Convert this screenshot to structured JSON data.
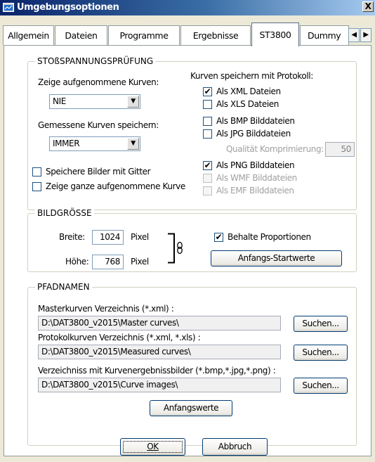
{
  "window": {
    "title": "Umgebungsoptionen",
    "close_label": "X"
  },
  "tabs": [
    {
      "label": "Allgemein"
    },
    {
      "label": "Dateien"
    },
    {
      "label": "Programme"
    },
    {
      "label": "Ergebnisse"
    },
    {
      "label": "ST3800"
    },
    {
      "label": "Dummy"
    }
  ],
  "active_tab": "ST3800",
  "tab_scroll": {
    "left_label": "◀",
    "right_label": "▶"
  },
  "stoss": {
    "title": "STOßSPANNUNGSPRÜFUNG",
    "show_curves_label": "Zeige aufgenommene Kurven:",
    "show_curves_value": "NIE",
    "save_curves_label": "Gemessene Kurven speichern:",
    "save_curves_value": "IMMER",
    "save_with_grid_label": "Speichere Bilder mit Gitter",
    "save_with_grid_checked": false,
    "show_full_curve_label": "Zeige ganze aufgenommene Kurve",
    "show_full_curve_checked": false,
    "protocol_label": "Kurven speichern mit Protokoll:",
    "as_xml_label": "Als XML Dateien",
    "as_xml_checked": true,
    "as_xls_label": "Als XLS Dateien",
    "as_xls_checked": false,
    "as_bmp_label": "Als BMP Bilddateien",
    "as_bmp_checked": false,
    "as_jpg_label": "Als JPG Bilddateien",
    "as_jpg_checked": false,
    "quality_label": "Qualität Komprimierung:",
    "quality_value": "50",
    "as_png_label": "Als PNG Bilddateien",
    "as_png_checked": true,
    "as_wmf_label": "Als WMF Bilddateien",
    "as_wmf_checked": false,
    "as_emf_label": "Als EMF Bilddateien",
    "as_emf_checked": false,
    "dropdown_glyph": "▼",
    "check_glyph": "✔"
  },
  "bildgroesse": {
    "title": "BILDGRÖSSE",
    "width_label": "Breite:",
    "width_value": "1024",
    "width_unit": "Pixel",
    "height_label": "Höhe:",
    "height_value": "768",
    "height_unit": "Pixel",
    "link_icon": "chain-link-icon",
    "keep_proportions_label": "Behalte Proportionen",
    "keep_proportions_checked": true,
    "defaults_button": "Anfangs-Startwerte"
  },
  "pfadnamen": {
    "title": "PFADNAMEN",
    "master_label": "Masterkurven Verzeichnis (*.xml) :",
    "master_value": "D:\\DAT3800_v2015\\Master curves\\",
    "protocol_label": "Protokolkurven Verzeichnis (*.xml, *.xls) :",
    "protocol_value": "D:\\DAT3800_v2015\\Measured curves\\",
    "images_label": "Verzeichniss mit Kurvenergebnissbilder (*.bmp,*.jpg,*.png) :",
    "images_value": "D:\\DAT3800_v2015\\Curve images\\",
    "search_button": "Suchen...",
    "defaults_button": "Anfangswerte"
  },
  "footer": {
    "ok_button": "OK",
    "cancel_button": "Abbruch"
  }
}
